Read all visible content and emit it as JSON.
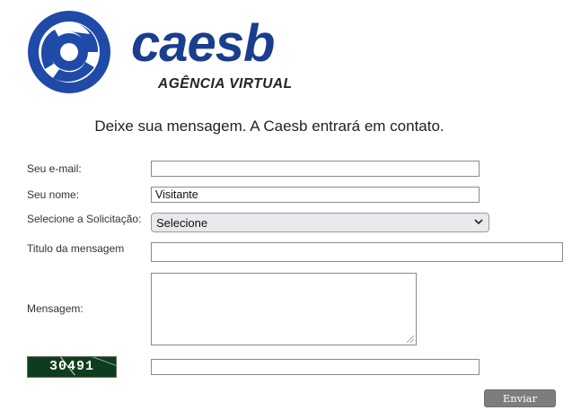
{
  "brand": {
    "name": "caesb",
    "subtitle": "AGÊNCIA VIRTUAL",
    "colors": {
      "primary": "#1a3e8f",
      "swirl": "#1f4aa8"
    }
  },
  "intro_text": "Deixe sua mensagem. A Caesb entrará em contato.",
  "form": {
    "email": {
      "label": "Seu e-mail:",
      "value": ""
    },
    "name": {
      "label": "Seu nome:",
      "value": "Visitante"
    },
    "request": {
      "label": "Selecione a Solicitação:",
      "selected": "Selecione",
      "icon": "chevron-down-icon"
    },
    "subject": {
      "label": "Titulo da mensagem",
      "value": ""
    },
    "message": {
      "label": "Mensagem:",
      "value": ""
    },
    "captcha": {
      "code": "30491",
      "answer": ""
    },
    "submit_label": "Enviar"
  }
}
